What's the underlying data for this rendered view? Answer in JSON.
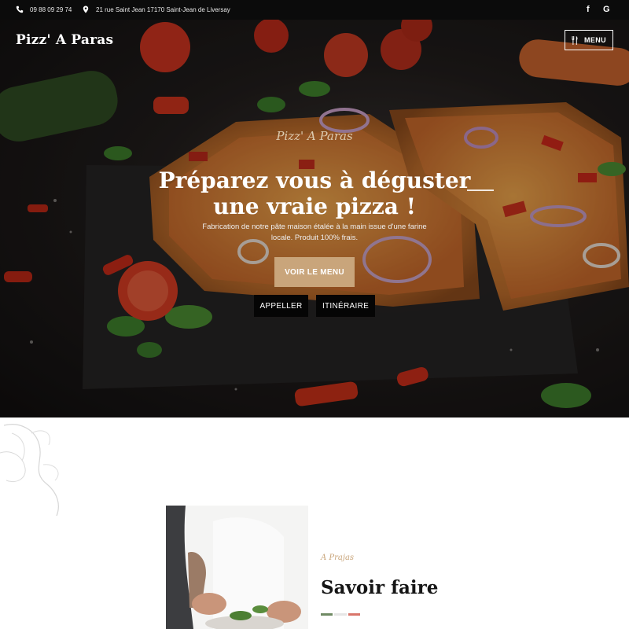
{
  "topbar": {
    "phone": "09 88 09 29 74",
    "address": "21 rue Saint Jean 17170 Saint-Jean de Liversay",
    "social": [
      {
        "icon": "facebook-icon",
        "glyph": "f"
      },
      {
        "icon": "google-icon",
        "glyph": "G"
      }
    ]
  },
  "header": {
    "logo": "Pizz' A Paras",
    "menu_label": "MENU"
  },
  "hero": {
    "script_title": "Pizz' A Paras",
    "headline_line1": "Préparez vous à déguster",
    "headline_line2": "une vraie pizza !",
    "subline_line1": "Fabrication de notre pâte maison étalée à la main issue d'une farine",
    "subline_line2": "locale. Produit 100% frais.",
    "cta_primary": "VOIR LE MENU",
    "cta_call": "APPELLER",
    "cta_route": "ITINÉRAIRE"
  },
  "about": {
    "small_script": "A Prajas",
    "title": "Savoir faire",
    "flag_colors": [
      "#6f8a63",
      "#e6e6e6",
      "#d9756a"
    ]
  },
  "colors": {
    "accent": "#c9a57b",
    "topbar_bg": "#0b0b0b",
    "button_dark": "#050505"
  }
}
